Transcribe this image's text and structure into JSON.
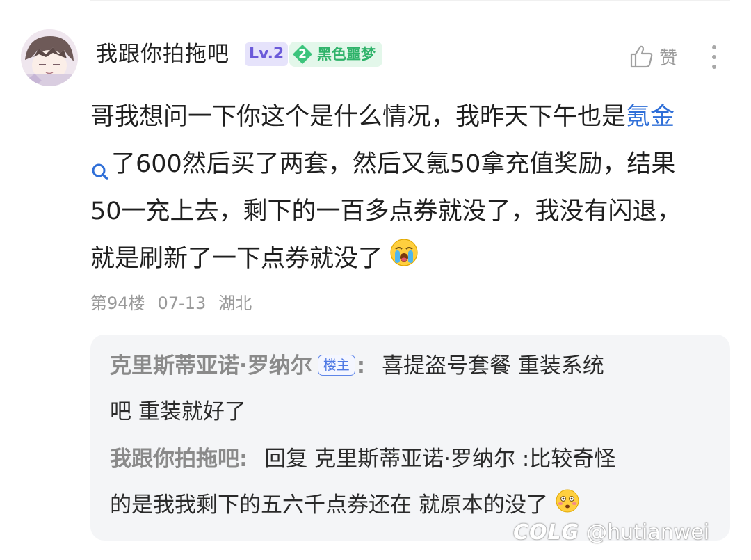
{
  "comment": {
    "author": "我跟你拍拖吧",
    "level": "Lv.2",
    "fan_badge": {
      "level": "2",
      "name": "黑色噩梦"
    },
    "like_label": "赞",
    "lines": [
      {
        "before": "哥我想问一下你这个是什么情况，我昨天下午也是",
        "keyword": "氪金"
      },
      {
        "text": "了600然后买了两套，然后又氪50拿充值奖励，结果"
      },
      {
        "text": "50一充上去，剩下的一百多点券就没了，我没有闪退，"
      },
      {
        "text": "就是刷新了一下点券就没了"
      }
    ],
    "floor": "第94楼",
    "date": "07-13",
    "location": "湖北"
  },
  "replies": [
    {
      "author": "克里斯蒂亚诺·罗纳尔",
      "badge": "楼主",
      "colon": ":",
      "line1": "喜提盗号套餐 重装系统",
      "line2": "吧 重装就好了"
    },
    {
      "author": "我跟你拍拖吧:",
      "line1": "回复 克里斯蒂亚诺·罗纳尔 :比较奇怪",
      "line2": "的是我我剩下的五六千点券还在 就原本的没了"
    }
  ],
  "watermark": {
    "logo": "COLG",
    "handle": "@hutianwei"
  },
  "colors": {
    "keyword": "#2f6fd8",
    "lv_badge": "#6b5ad9",
    "fan_badge": "#2fb36a",
    "op_badge": "#4f79e4",
    "reply_bg": "#f4f5f7"
  }
}
